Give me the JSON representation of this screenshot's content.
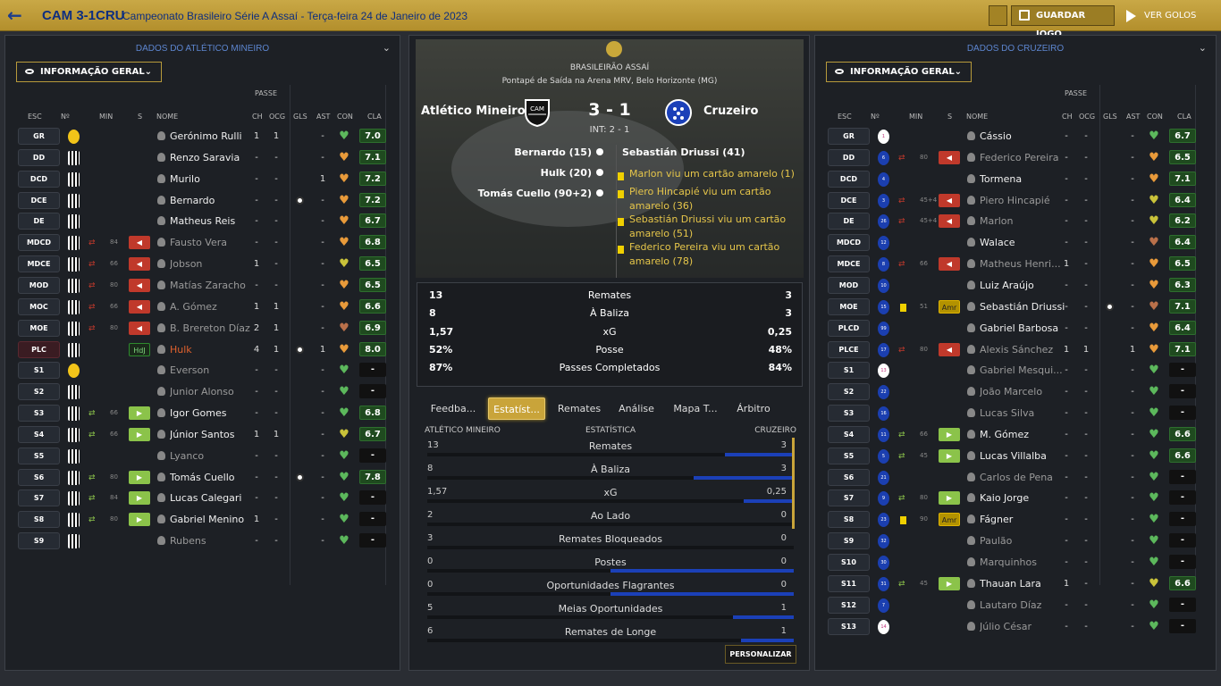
{
  "topbar": {
    "score": "CAM 3-1CRU",
    "competition": "Campeonato Brasileiro Série A Assaí - Terça-feira 24 de Janeiro de 2023",
    "save": "GUARDAR JOGO",
    "goals": "VER GOLOS"
  },
  "left": {
    "title": "DADOS DO ATLÉTICO MINEIRO",
    "dropdown": "INFORMAÇÃO GERAL",
    "headers": {
      "passe": "PASSE",
      "esc": "ESC",
      "no": "Nº",
      "min": "MIN",
      "s": "S",
      "nome": "NOME",
      "ch": "CH",
      "ocg": "OCG",
      "gls": "GLS",
      "ast": "AST",
      "con": "CON",
      "cla": "CLA"
    },
    "rows": [
      {
        "pos": "GR",
        "shirt": "gk",
        "name": "Gerónimo Rulli",
        "st": "on",
        "ch": "1",
        "ocg": "1",
        "gls": "",
        "ast": "-",
        "con": "green",
        "cla": "7.0",
        "sub": ""
      },
      {
        "pos": "DD",
        "shirt": "s",
        "name": "Renzo Saravia",
        "st": "on",
        "ch": "-",
        "ocg": "-",
        "gls": "",
        "ast": "-",
        "con": "orange",
        "cla": "7.1",
        "sub": ""
      },
      {
        "pos": "DCD",
        "shirt": "s",
        "name": "Murilo",
        "st": "on",
        "ch": "-",
        "ocg": "-",
        "gls": "",
        "ast": "1",
        "con": "orange",
        "cla": "7.2",
        "sub": ""
      },
      {
        "pos": "DCE",
        "shirt": "s",
        "name": "Bernardo",
        "st": "on",
        "ch": "-",
        "ocg": "-",
        "gls": "ball",
        "ast": "-",
        "con": "orange",
        "cla": "7.2",
        "sub": ""
      },
      {
        "pos": "DE",
        "shirt": "s",
        "name": "Matheus Reis",
        "st": "on",
        "ch": "-",
        "ocg": "-",
        "gls": "",
        "ast": "-",
        "con": "orange",
        "cla": "6.7",
        "sub": ""
      },
      {
        "pos": "MDCD",
        "shirt": "s",
        "name": "Fausto Vera",
        "st": "off",
        "ch": "-",
        "ocg": "-",
        "gls": "",
        "ast": "-",
        "con": "orange",
        "cla": "6.8",
        "sub": "out",
        "min": "84"
      },
      {
        "pos": "MDCE",
        "shirt": "s",
        "name": "Jobson",
        "st": "off",
        "ch": "1",
        "ocg": "-",
        "gls": "",
        "ast": "-",
        "con": "yellow",
        "cla": "6.5",
        "sub": "out",
        "min": "66"
      },
      {
        "pos": "MOD",
        "shirt": "s",
        "name": "Matías Zaracho",
        "st": "off",
        "ch": "-",
        "ocg": "-",
        "gls": "",
        "ast": "-",
        "con": "orange",
        "cla": "6.5",
        "sub": "out",
        "min": "80"
      },
      {
        "pos": "MOC",
        "shirt": "s",
        "name": "A. Gómez",
        "st": "off",
        "ch": "1",
        "ocg": "1",
        "gls": "",
        "ast": "-",
        "con": "orange",
        "cla": "6.6",
        "sub": "out",
        "min": "66"
      },
      {
        "pos": "MOE",
        "shirt": "s",
        "name": "B. Brereton Díaz",
        "st": "off",
        "ch": "2",
        "ocg": "1",
        "gls": "",
        "ast": "-",
        "con": "brown",
        "cla": "6.9",
        "sub": "out",
        "min": "80"
      },
      {
        "pos": "PLC",
        "shirt": "s",
        "name": "Hulk",
        "st": "red",
        "ch": "4",
        "ocg": "1",
        "gls": "ball",
        "ast": "1",
        "con": "orange",
        "cla": "8.0",
        "sub": "hdj",
        "red": true
      },
      {
        "pos": "S1",
        "shirt": "gk",
        "name": "Everson",
        "st": "off",
        "ch": "-",
        "ocg": "-",
        "gls": "",
        "ast": "-",
        "con": "green",
        "cla": "-",
        "sub": ""
      },
      {
        "pos": "S2",
        "shirt": "s",
        "name": "Junior Alonso",
        "st": "off",
        "ch": "-",
        "ocg": "-",
        "gls": "",
        "ast": "-",
        "con": "green",
        "cla": "-",
        "sub": ""
      },
      {
        "pos": "S3",
        "shirt": "s",
        "name": "Igor Gomes",
        "st": "on",
        "ch": "-",
        "ocg": "-",
        "gls": "",
        "ast": "-",
        "con": "green",
        "cla": "6.8",
        "sub": "in",
        "min": "66"
      },
      {
        "pos": "S4",
        "shirt": "s",
        "name": "Júnior Santos",
        "st": "on",
        "ch": "1",
        "ocg": "1",
        "gls": "",
        "ast": "-",
        "con": "yellow",
        "cla": "6.7",
        "sub": "in",
        "min": "66"
      },
      {
        "pos": "S5",
        "shirt": "s",
        "name": "Lyanco",
        "st": "off",
        "ch": "-",
        "ocg": "-",
        "gls": "",
        "ast": "-",
        "con": "green",
        "cla": "-",
        "sub": ""
      },
      {
        "pos": "S6",
        "shirt": "s",
        "name": "Tomás Cuello",
        "st": "on",
        "ch": "-",
        "ocg": "-",
        "gls": "ball",
        "ast": "-",
        "con": "green",
        "cla": "7.8",
        "sub": "in",
        "min": "80"
      },
      {
        "pos": "S7",
        "shirt": "s",
        "name": "Lucas Calegari",
        "st": "on",
        "ch": "-",
        "ocg": "-",
        "gls": "",
        "ast": "-",
        "con": "green",
        "cla": "-",
        "sub": "in",
        "min": "84"
      },
      {
        "pos": "S8",
        "shirt": "s",
        "name": "Gabriel Menino",
        "st": "on",
        "ch": "1",
        "ocg": "-",
        "gls": "",
        "ast": "-",
        "con": "green",
        "cla": "-",
        "sub": "in",
        "min": "80"
      },
      {
        "pos": "S9",
        "shirt": "s",
        "name": "Rubens",
        "st": "off",
        "ch": "-",
        "ocg": "-",
        "gls": "",
        "ast": "-",
        "con": "green",
        "cla": "-",
        "sub": ""
      }
    ]
  },
  "right": {
    "title": "DADOS DO CRUZEIRO",
    "dropdown": "INFORMAÇÃO GERAL",
    "headers": {
      "passe": "PASSE",
      "esc": "ESC",
      "no": "Nº",
      "min": "MIN",
      "s": "S",
      "nome": "NOME",
      "ch": "CH",
      "ocg": "OCG",
      "gls": "GLS",
      "ast": "AST",
      "con": "CON",
      "cla": "CLA"
    },
    "rows": [
      {
        "pos": "GR",
        "shirt": "gk",
        "num": "1",
        "name": "Cássio",
        "st": "on",
        "ch": "-",
        "ocg": "-",
        "gls": "",
        "ast": "-",
        "con": "green",
        "cla": "6.7",
        "sub": ""
      },
      {
        "pos": "DD",
        "shirt": "c",
        "num": "6",
        "name": "Federico Pereira",
        "st": "off",
        "ch": "-",
        "ocg": "-",
        "gls": "",
        "ast": "-",
        "con": "orange",
        "cla": "6.5",
        "sub": "out",
        "min": "80"
      },
      {
        "pos": "DCD",
        "shirt": "c",
        "num": "4",
        "name": "Tormena",
        "st": "on",
        "ch": "-",
        "ocg": "-",
        "gls": "",
        "ast": "-",
        "con": "orange",
        "cla": "7.1",
        "sub": ""
      },
      {
        "pos": "DCE",
        "shirt": "c",
        "num": "3",
        "name": "Piero Hincapié",
        "st": "off",
        "ch": "-",
        "ocg": "-",
        "gls": "",
        "ast": "-",
        "con": "yellow",
        "cla": "6.4",
        "sub": "out",
        "min": "45+4"
      },
      {
        "pos": "DE",
        "shirt": "c",
        "num": "26",
        "name": "Marlon",
        "st": "off",
        "ch": "-",
        "ocg": "-",
        "gls": "",
        "ast": "-",
        "con": "yellow",
        "cla": "6.2",
        "sub": "out",
        "min": "45+4"
      },
      {
        "pos": "MDCD",
        "shirt": "c",
        "num": "12",
        "name": "Walace",
        "st": "on",
        "ch": "-",
        "ocg": "-",
        "gls": "",
        "ast": "-",
        "con": "brown",
        "cla": "6.4",
        "sub": ""
      },
      {
        "pos": "MDCE",
        "shirt": "c",
        "num": "8",
        "name": "Matheus Henri...",
        "st": "off",
        "ch": "1",
        "ocg": "-",
        "gls": "",
        "ast": "-",
        "con": "orange",
        "cla": "6.5",
        "sub": "out",
        "min": "66"
      },
      {
        "pos": "MOD",
        "shirt": "c",
        "num": "10",
        "name": "Luiz Araújo",
        "st": "on",
        "ch": "-",
        "ocg": "-",
        "gls": "",
        "ast": "-",
        "con": "orange",
        "cla": "6.3",
        "sub": ""
      },
      {
        "pos": "MOE",
        "shirt": "c",
        "num": "15",
        "name": "Sebastián Driussi",
        "st": "on",
        "ch": "-",
        "ocg": "-",
        "gls": "ball",
        "ast": "-",
        "con": "brown",
        "cla": "7.1",
        "sub": "amr",
        "min": "51"
      },
      {
        "pos": "PLCD",
        "shirt": "c",
        "num": "99",
        "name": "Gabriel Barbosa",
        "st": "on",
        "ch": "-",
        "ocg": "-",
        "gls": "",
        "ast": "-",
        "con": "orange",
        "cla": "6.4",
        "sub": ""
      },
      {
        "pos": "PLCE",
        "shirt": "c",
        "num": "17",
        "name": "Alexis Sánchez",
        "st": "off",
        "ch": "1",
        "ocg": "1",
        "gls": "",
        "ast": "1",
        "con": "orange",
        "cla": "7.1",
        "sub": "out",
        "min": "80"
      },
      {
        "pos": "S1",
        "shirt": "gk",
        "num": "13",
        "name": "Gabriel Mesqui...",
        "st": "off",
        "ch": "-",
        "ocg": "-",
        "gls": "",
        "ast": "-",
        "con": "green",
        "cla": "-",
        "sub": ""
      },
      {
        "pos": "S2",
        "shirt": "c",
        "num": "22",
        "name": "João Marcelo",
        "st": "off",
        "ch": "-",
        "ocg": "-",
        "gls": "",
        "ast": "-",
        "con": "green",
        "cla": "-",
        "sub": ""
      },
      {
        "pos": "S3",
        "shirt": "c",
        "num": "16",
        "name": "Lucas Silva",
        "st": "off",
        "ch": "-",
        "ocg": "-",
        "gls": "",
        "ast": "-",
        "con": "green",
        "cla": "-",
        "sub": ""
      },
      {
        "pos": "S4",
        "shirt": "c",
        "num": "11",
        "name": "M. Gómez",
        "st": "on",
        "ch": "-",
        "ocg": "-",
        "gls": "",
        "ast": "-",
        "con": "green",
        "cla": "6.6",
        "sub": "in",
        "min": "66"
      },
      {
        "pos": "S5",
        "shirt": "c",
        "num": "5",
        "name": "Lucas Villalba",
        "st": "on",
        "ch": "-",
        "ocg": "-",
        "gls": "",
        "ast": "-",
        "con": "green",
        "cla": "6.6",
        "sub": "in",
        "min": "45"
      },
      {
        "pos": "S6",
        "shirt": "c",
        "num": "21",
        "name": "Carlos de Pena",
        "st": "off",
        "ch": "-",
        "ocg": "-",
        "gls": "",
        "ast": "-",
        "con": "green",
        "cla": "-",
        "sub": ""
      },
      {
        "pos": "S7",
        "shirt": "c",
        "num": "9",
        "name": "Kaio Jorge",
        "st": "on",
        "ch": "-",
        "ocg": "-",
        "gls": "",
        "ast": "-",
        "con": "green",
        "cla": "-",
        "sub": "in",
        "min": "80"
      },
      {
        "pos": "S8",
        "shirt": "c",
        "num": "23",
        "name": "Fágner",
        "st": "on",
        "ch": "-",
        "ocg": "-",
        "gls": "",
        "ast": "-",
        "con": "green",
        "cla": "-",
        "sub": "amr",
        "min": "90"
      },
      {
        "pos": "S9",
        "shirt": "c",
        "num": "32",
        "name": "Paulão",
        "st": "off",
        "ch": "-",
        "ocg": "-",
        "gls": "",
        "ast": "-",
        "con": "green",
        "cla": "-",
        "sub": ""
      },
      {
        "pos": "S10",
        "shirt": "c",
        "num": "30",
        "name": "Marquinhos",
        "st": "off",
        "ch": "-",
        "ocg": "-",
        "gls": "",
        "ast": "-",
        "con": "green",
        "cla": "-",
        "sub": ""
      },
      {
        "pos": "S11",
        "shirt": "c",
        "num": "31",
        "name": "Thauan Lara",
        "st": "on",
        "ch": "1",
        "ocg": "-",
        "gls": "",
        "ast": "-",
        "con": "yellow",
        "cla": "6.6",
        "sub": "in",
        "min": "45"
      },
      {
        "pos": "S12",
        "shirt": "c",
        "num": "7",
        "name": "Lautaro Díaz",
        "st": "off",
        "ch": "-",
        "ocg": "-",
        "gls": "",
        "ast": "-",
        "con": "green",
        "cla": "-",
        "sub": ""
      },
      {
        "pos": "S13",
        "shirt": "gk",
        "num": "14",
        "name": "Júlio César",
        "st": "off",
        "ch": "-",
        "ocg": "-",
        "gls": "",
        "ast": "-",
        "con": "green",
        "cla": "-",
        "sub": ""
      }
    ]
  },
  "match": {
    "competition": "BRASILEIRÃO ASSAÍ",
    "kickoff": "Pontapé de Saída na Arena MRV, Belo Horizonte (MG)",
    "home": "Atlético Mineiro",
    "away": "Cruzeiro",
    "score": "3 - 1",
    "halftime": "INT: 2 - 1",
    "home_goals": [
      "Bernardo (15)",
      "Hulk (20)",
      "Tomás Cuello (90+2)"
    ],
    "away_goals": [
      "Sebastián Driussi (41)"
    ],
    "events": [
      "Marlon viu um cartão amarelo (1)",
      "Piero Hincapié viu um cartão amarelo (36)",
      "Sebastián Driussi viu um cartão amarelo (51)",
      "Federico Pereira viu um cartão amarelo (78)"
    ],
    "summary": [
      [
        "13",
        "Remates",
        "3"
      ],
      [
        "8",
        "À Baliza",
        "3"
      ],
      [
        "1,57",
        "xG",
        "0,25"
      ],
      [
        "52%",
        "Posse",
        "48%"
      ],
      [
        "87%",
        "Passes Completados",
        "84%"
      ]
    ],
    "tabs": [
      "Feedba...",
      "Estatíst...",
      "Remates",
      "Análise",
      "Mapa T...",
      "Árbitro"
    ],
    "detail_head": {
      "home": "ATLÉTICO MINEIRO",
      "mid": "ESTATÍSTICA",
      "away": "CRUZEIRO"
    },
    "detail": [
      {
        "h": "13",
        "label": "Remates",
        "a": "3",
        "hv": 13,
        "av": 3
      },
      {
        "h": "8",
        "label": "À Baliza",
        "a": "3",
        "hv": 8,
        "av": 3
      },
      {
        "h": "1,57",
        "label": "xG",
        "a": "0,25",
        "hv": 1.57,
        "av": 0.25
      },
      {
        "h": "2",
        "label": "Ao Lado",
        "a": "0",
        "hv": 2,
        "av": 0
      },
      {
        "h": "3",
        "label": "Remates Bloqueados",
        "a": "0",
        "hv": 3,
        "av": 0
      },
      {
        "h": "0",
        "label": "Postes",
        "a": "0",
        "hv": 0,
        "av": 0
      },
      {
        "h": "0",
        "label": "Oportunidades Flagrantes",
        "a": "0",
        "hv": 0,
        "av": 0
      },
      {
        "h": "5",
        "label": "Meias Oportunidades",
        "a": "1",
        "hv": 5,
        "av": 1
      },
      {
        "h": "6",
        "label": "Remates de Longe",
        "a": "1",
        "hv": 6,
        "av": 1
      }
    ],
    "personalize": "PERSONALIZAR"
  },
  "colors": {
    "accent": "#c9a43a",
    "away_bar": "#1b40b8",
    "green": "#8bc34a",
    "red": "#c0392b"
  }
}
